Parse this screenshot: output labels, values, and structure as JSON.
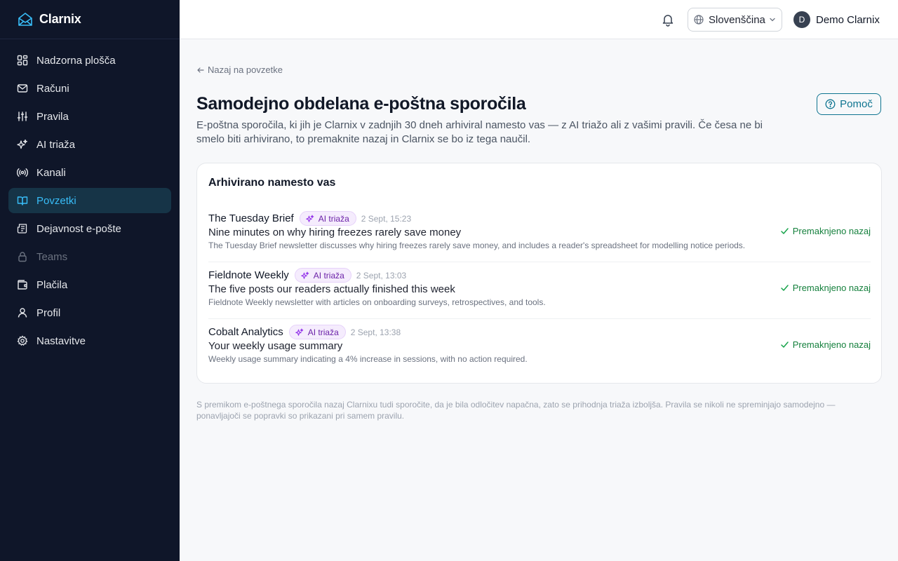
{
  "app": {
    "name": "Clarnix",
    "accent": "#38bdf8",
    "sidebar_bg": "#0f1629"
  },
  "sidebar": {
    "items": [
      {
        "label": "Nadzorna plošča",
        "icon": "dashboard-icon"
      },
      {
        "label": "Računi",
        "icon": "mail-icon"
      },
      {
        "label": "Pravila",
        "icon": "sliders-icon"
      },
      {
        "label": "AI triaža",
        "icon": "sparkles-icon"
      },
      {
        "label": "Kanali",
        "icon": "broadcast-icon"
      },
      {
        "label": "Povzetki",
        "icon": "book-open-icon",
        "active": true
      },
      {
        "label": "Dejavnost e-pošte",
        "icon": "newspaper-icon"
      },
      {
        "label": "Teams",
        "icon": "lock-icon",
        "disabled": true
      },
      {
        "label": "Plačila",
        "icon": "wallet-icon"
      },
      {
        "label": "Profil",
        "icon": "user-icon"
      },
      {
        "label": "Nastavitve",
        "icon": "gear-icon"
      }
    ]
  },
  "header": {
    "language": "Slovenščina",
    "user_initial": "D",
    "user_name": "Demo Clarnix"
  },
  "main": {
    "back_label": "Nazaj na povzetke",
    "title": "Samodejno obdelana e-poštna sporočila",
    "subtitle": "E-poštna sporočila, ki jih je Clarnix v zadnjih 30 dneh arhiviral namesto vas — z AI triažo ali z vašimi pravili. Če česa ne bi smelo biti arhivirano, to premaknite nazaj in Clarnix se bo iz tega naučil.",
    "help_label": "Pomoč",
    "card_title": "Arhivirano namesto vas",
    "rows": [
      {
        "sender": "The Tuesday Brief",
        "badge": "AI triaža",
        "time": "2 Sept, 15:23",
        "subject": "Nine minutes on why hiring freezes rarely save money",
        "summary": "The Tuesday Brief newsletter discusses why hiring freezes rarely save money, and includes a reader's spreadsheet for modelling notice periods.",
        "status": "Premaknjeno nazaj"
      },
      {
        "sender": "Fieldnote Weekly",
        "badge": "AI triaža",
        "time": "2 Sept, 13:03",
        "subject": "The five posts our readers actually finished this week",
        "summary": "Fieldnote Weekly newsletter with articles on onboarding surveys, retrospectives, and tools.",
        "status": "Premaknjeno nazaj"
      },
      {
        "sender": "Cobalt Analytics",
        "badge": "AI triaža",
        "time": "2 Sept, 13:38",
        "subject": "Your weekly usage summary",
        "summary": "Weekly usage summary indicating a 4% increase in sessions, with no action required.",
        "status": "Premaknjeno nazaj"
      }
    ],
    "footnote": "S premikom e-poštnega sporočila nazaj Clarnixu tudi sporočite, da je bila odločitev napačna, zato se prihodnja triaža izboljša. Pravila se nikoli ne spreminjajo samodejno — ponavljajoči se popravki so prikazani pri samem pravilu."
  }
}
